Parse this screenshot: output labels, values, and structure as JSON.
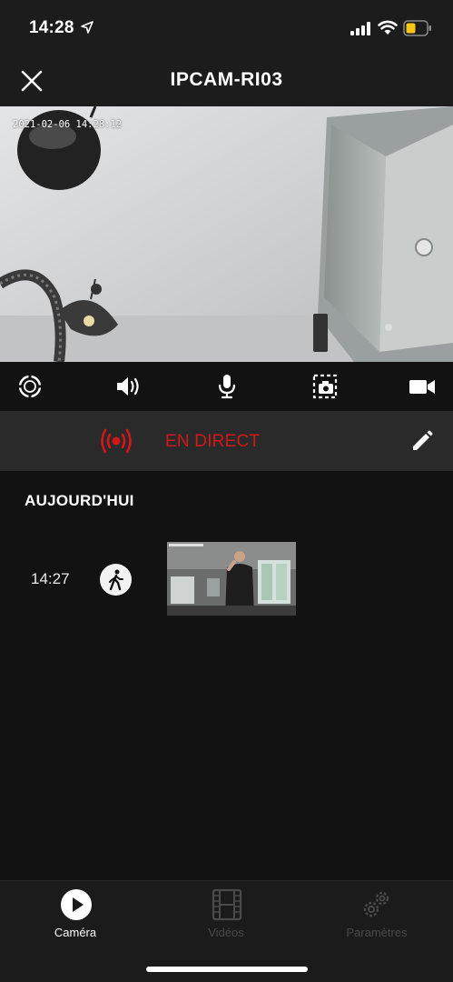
{
  "status_bar": {
    "time": "14:28",
    "icons": [
      "location-arrow-icon",
      "cellular-signal-icon",
      "wifi-icon",
      "battery-icon"
    ],
    "battery_color": "#f5c518"
  },
  "nav": {
    "title": "IPCAM-RI03",
    "close_icon": "close-icon"
  },
  "camera": {
    "timestamp": "2021-02-06 14:28:12"
  },
  "controls": [
    {
      "name": "ptz-control-icon"
    },
    {
      "name": "speaker-volume-icon"
    },
    {
      "name": "microphone-icon"
    },
    {
      "name": "snapshot-icon"
    },
    {
      "name": "record-video-icon"
    }
  ],
  "live": {
    "label": "EN DIRECT",
    "color": "#d01818",
    "edit_icon": "pencil-icon"
  },
  "events": {
    "section_title": "AUJOURD'HUI",
    "items": [
      {
        "time": "14:27",
        "type_icon": "motion-walking-icon"
      }
    ]
  },
  "tabs": [
    {
      "label": "Caméra",
      "icon": "play-circle-icon",
      "active": true
    },
    {
      "label": "Vidéos",
      "icon": "film-strip-icon",
      "active": false
    },
    {
      "label": "Paramètres",
      "icon": "gears-icon",
      "active": false
    }
  ],
  "colors": {
    "background": "#121212",
    "bar": "#1c1c1c",
    "live_bar": "#2a2a2a",
    "accent_red": "#d01818"
  }
}
